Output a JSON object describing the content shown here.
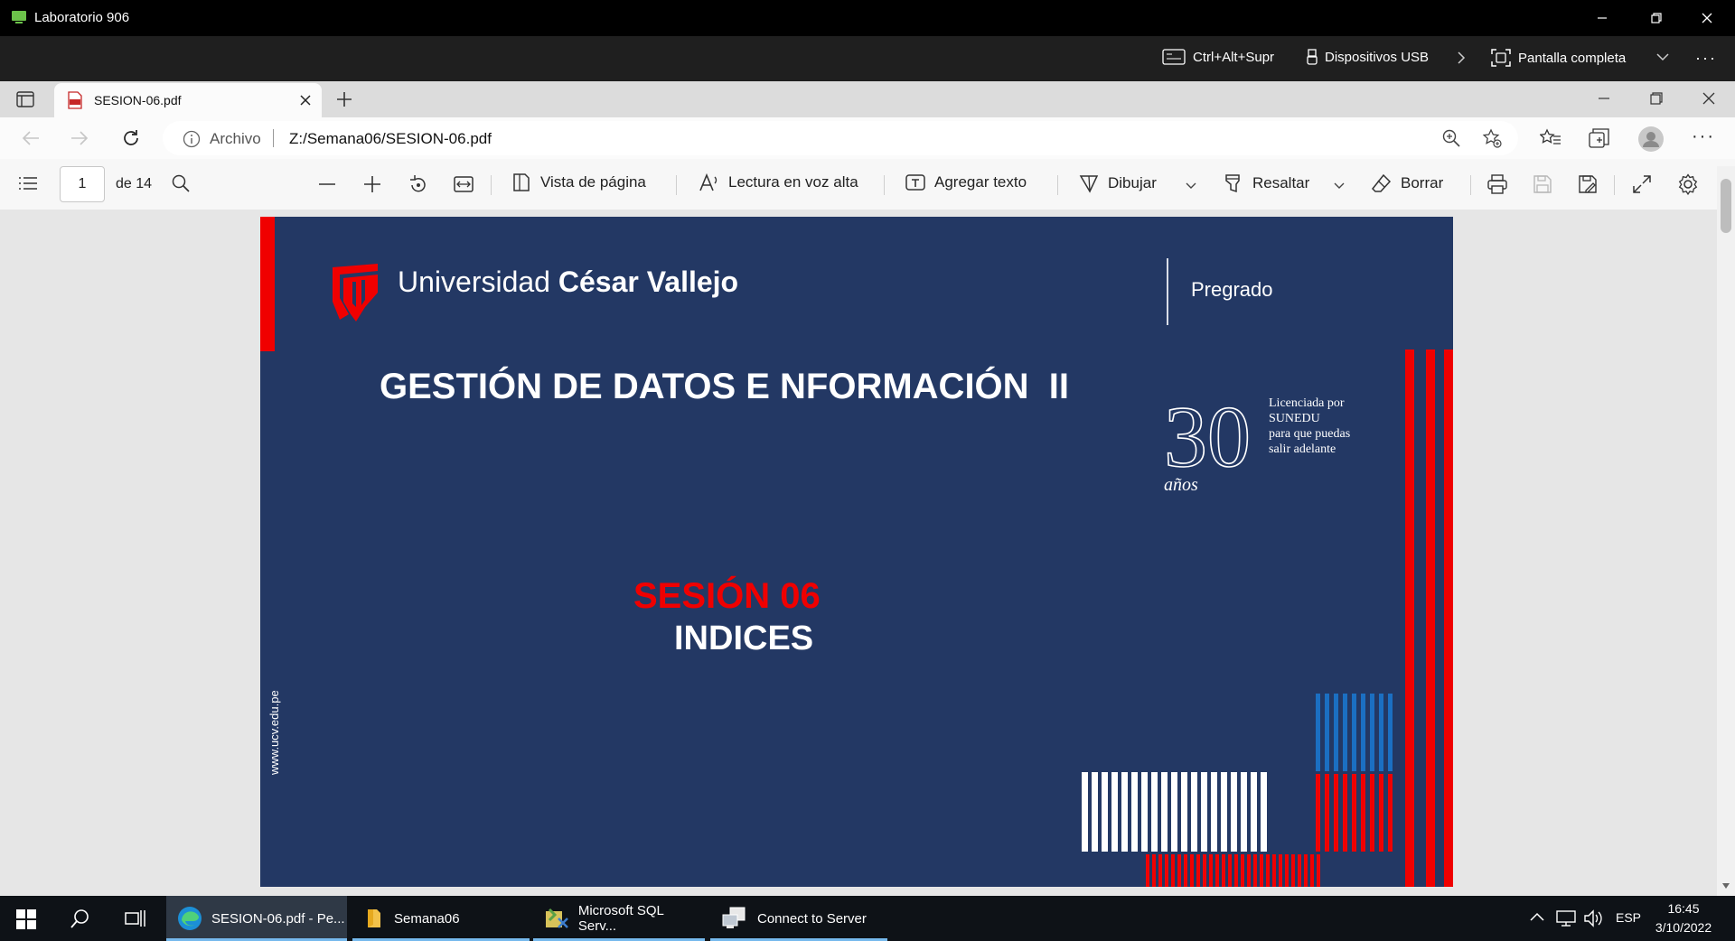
{
  "remote_window": {
    "title": "Laboratorio 906"
  },
  "rdp_toolbar": {
    "ctrl_alt_del": "Ctrl+Alt+Supr",
    "usb_devices": "Dispositivos USB",
    "fullscreen": "Pantalla completa"
  },
  "browser": {
    "tab_title": "SESION-06.pdf",
    "address_label": "Archivo",
    "url": "Z:/Semana06/SESION-06.pdf"
  },
  "pdf_toolbar": {
    "page_current": "1",
    "page_total": "de 14",
    "page_view": "Vista de página",
    "read_aloud": "Lectura en voz alta",
    "add_text": "Agregar texto",
    "draw": "Dibujar",
    "highlight": "Resaltar",
    "erase": "Borrar"
  },
  "slide": {
    "logo_word1": "Universidad",
    "logo_word2": "César Vallejo",
    "category": "Pregrado",
    "course_title": "GESTIÓN DE DATOS E NFORMACIÓN  II",
    "anniversary_number": "30",
    "anniversary_word": "años",
    "license_lines": [
      "Licenciada por",
      "SUNEDU",
      "para que puedas",
      "salir adelante"
    ],
    "session": "SESIÓN 06",
    "topic": "INDICES",
    "website": "www.ucv.edu.pe",
    "colors": {
      "background": "#233864",
      "red": "#f00000",
      "blue": "#1b6fc2",
      "white": "#ffffff"
    }
  },
  "taskbar": {
    "apps": [
      {
        "label": "SESION-06.pdf - Pe..."
      },
      {
        "label": "Semana06"
      },
      {
        "label": "Microsoft SQL Serv..."
      },
      {
        "label": "Connect to Server"
      }
    ],
    "language": "ESP",
    "time": "16:45",
    "date": "3/10/2022"
  }
}
